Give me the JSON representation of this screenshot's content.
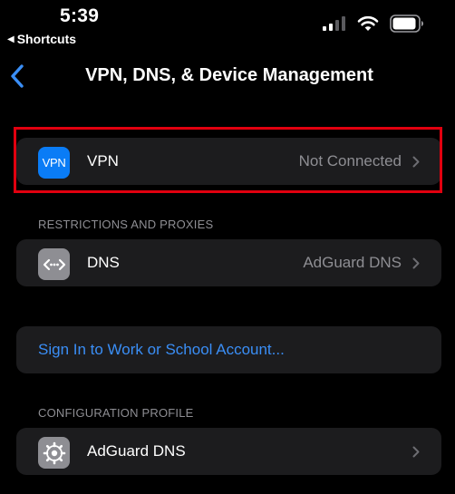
{
  "status_bar": {
    "time": "5:39",
    "back_app": "Shortcuts",
    "back_triangle": "◀"
  },
  "nav": {
    "title": "VPN, DNS, & Device Management",
    "back_icon": "chevron-left-icon"
  },
  "vpn_row": {
    "icon_text": "VPN",
    "label": "VPN",
    "value": "Not Connected",
    "icon_color": "#0a7cf6"
  },
  "restrictions_section": {
    "header": "RESTRICTIONS AND PROXIES",
    "dns_row": {
      "label": "DNS",
      "value": "AdGuard DNS",
      "icon": "dns-arrows-icon"
    }
  },
  "sign_in": {
    "label": "Sign In to Work or School Account..."
  },
  "configuration_section": {
    "header": "CONFIGURATION PROFILE",
    "profile_row": {
      "label": "AdGuard DNS",
      "icon": "gear-icon"
    }
  },
  "colors": {
    "background": "#000000",
    "group_background": "#1c1c1e",
    "accent_blue": "#3a8ef6",
    "secondary_text": "#8e8e93",
    "highlight_red": "#e1000f"
  }
}
